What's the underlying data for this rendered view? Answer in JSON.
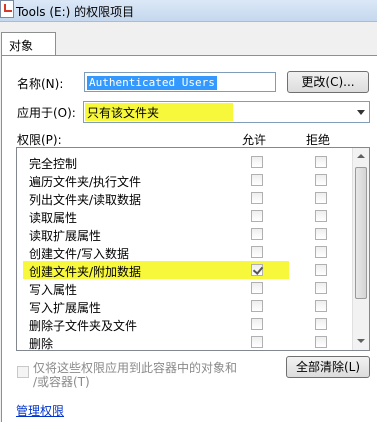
{
  "window": {
    "title": "Tools (E:) 的权限项目"
  },
  "tabs": [
    {
      "label": "对象"
    }
  ],
  "name_row": {
    "label": "名称(N):",
    "value": "Authenticated Users",
    "change_button": "更改(C)..."
  },
  "apply_to": {
    "label": "应用于(O):",
    "selected": "只有该文件夹",
    "highlight_color": "#f7f73c"
  },
  "permissions": {
    "label": "权限(P):",
    "col_allow": "允许",
    "col_deny": "拒绝",
    "rows": [
      {
        "label": "完全控制",
        "allow": false,
        "deny": false
      },
      {
        "label": "遍历文件夹/执行文件",
        "allow": false,
        "deny": false
      },
      {
        "label": "列出文件夹/读取数据",
        "allow": false,
        "deny": false
      },
      {
        "label": "读取属性",
        "allow": false,
        "deny": false
      },
      {
        "label": "读取扩展属性",
        "allow": false,
        "deny": false
      },
      {
        "label": "创建文件/写入数据",
        "allow": false,
        "deny": false
      },
      {
        "label": "创建文件夹/附加数据",
        "allow": true,
        "deny": false,
        "highlighted": true
      },
      {
        "label": "写入属性",
        "allow": false,
        "deny": false
      },
      {
        "label": "写入扩展属性",
        "allow": false,
        "deny": false
      },
      {
        "label": "删除子文件夹及文件",
        "allow": false,
        "deny": false
      },
      {
        "label": "删除",
        "allow": false,
        "deny": false
      }
    ]
  },
  "apply_checkbox": {
    "line1": "仅将这些权限应用到此容器中的对象和",
    "line2": "/或容器(T)",
    "checked": false
  },
  "clear_all_button": "全部清除(L)",
  "manage_link": "管理权限"
}
